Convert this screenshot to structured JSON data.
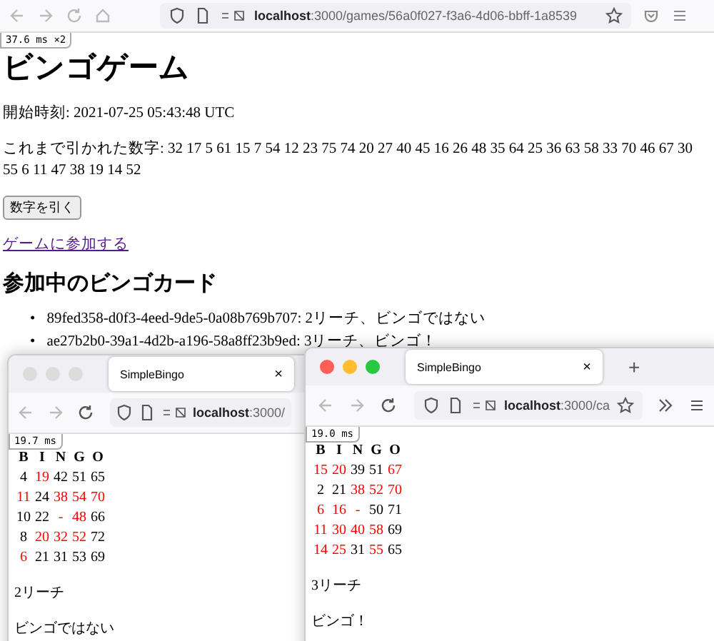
{
  "browser": {
    "url_host": "localhost",
    "url_path": ":3000/games/56a0f027-f3a6-4d06-bbff-1a8539",
    "perf_badge": "37.6 ms ×2"
  },
  "page": {
    "title": "ビンゴゲーム",
    "start_time": "開始時刻: 2021-07-25 05:43:48 UTC",
    "drawn_numbers": "これまで引かれた数字: 32 17 5 61 15 7 54 12 23 75 74 20 27 40 45 16 26 48 35 64 25 36 63 58 33 70 46 67 30 55 6 11 47 38 19 14 52",
    "draw_button": "数字を引く",
    "join_link": "ゲームに参加する",
    "cards_heading": "参加中のビンゴカード",
    "card_list": [
      {
        "marker": "•",
        "text": "89fed358-d0f3-4eed-9de5-0a08b769b707: 2リーチ、ビンゴではない"
      },
      {
        "marker": "•",
        "text": "ae27b2b0-39a1-4d2b-a196-58a8ff23b9ed: 3リーチ、ビンゴ！"
      }
    ]
  },
  "windows": [
    {
      "active": false,
      "tab_title": "SimpleBingo",
      "tab_close": "×",
      "url_host": "localhost",
      "url_path": ":3000/",
      "perf_badge": "19.7 ms",
      "header": [
        "B",
        "I",
        "N",
        "G",
        "O"
      ],
      "rows": [
        [
          {
            "n": "4",
            "marked": false
          },
          {
            "n": "19",
            "marked": true
          },
          {
            "n": "42",
            "marked": false
          },
          {
            "n": "51",
            "marked": false
          },
          {
            "n": "65",
            "marked": false
          }
        ],
        [
          {
            "n": "11",
            "marked": true
          },
          {
            "n": "24",
            "marked": false
          },
          {
            "n": "38",
            "marked": true
          },
          {
            "n": "54",
            "marked": true
          },
          {
            "n": "70",
            "marked": true
          }
        ],
        [
          {
            "n": "10",
            "marked": false
          },
          {
            "n": "22",
            "marked": false
          },
          {
            "n": "-",
            "marked": true
          },
          {
            "n": "48",
            "marked": true
          },
          {
            "n": "66",
            "marked": false
          }
        ],
        [
          {
            "n": "8",
            "marked": false
          },
          {
            "n": "20",
            "marked": true
          },
          {
            "n": "32",
            "marked": true
          },
          {
            "n": "52",
            "marked": true
          },
          {
            "n": "72",
            "marked": false
          }
        ],
        [
          {
            "n": "6",
            "marked": true
          },
          {
            "n": "21",
            "marked": false
          },
          {
            "n": "31",
            "marked": false
          },
          {
            "n": "53",
            "marked": false
          },
          {
            "n": "69",
            "marked": false
          }
        ]
      ],
      "reach": "2リーチ",
      "bingo": "ビンゴではない"
    },
    {
      "active": true,
      "tab_title": "SimpleBingo",
      "tab_close": "×",
      "new_tab": "+",
      "url_host": "localhost",
      "url_path": ":3000/ca",
      "perf_badge": "19.0 ms",
      "header": [
        "B",
        "I",
        "N",
        "G",
        "O"
      ],
      "rows": [
        [
          {
            "n": "15",
            "marked": true
          },
          {
            "n": "20",
            "marked": true
          },
          {
            "n": "39",
            "marked": false
          },
          {
            "n": "51",
            "marked": false
          },
          {
            "n": "67",
            "marked": true
          }
        ],
        [
          {
            "n": "2",
            "marked": false
          },
          {
            "n": "21",
            "marked": false
          },
          {
            "n": "38",
            "marked": true
          },
          {
            "n": "52",
            "marked": true
          },
          {
            "n": "70",
            "marked": true
          }
        ],
        [
          {
            "n": "6",
            "marked": true
          },
          {
            "n": "16",
            "marked": true
          },
          {
            "n": "-",
            "marked": true
          },
          {
            "n": "50",
            "marked": false
          },
          {
            "n": "71",
            "marked": false
          }
        ],
        [
          {
            "n": "11",
            "marked": true
          },
          {
            "n": "30",
            "marked": true
          },
          {
            "n": "40",
            "marked": true
          },
          {
            "n": "58",
            "marked": true
          },
          {
            "n": "69",
            "marked": false
          }
        ],
        [
          {
            "n": "14",
            "marked": true
          },
          {
            "n": "25",
            "marked": true
          },
          {
            "n": "31",
            "marked": false
          },
          {
            "n": "55",
            "marked": true
          },
          {
            "n": "65",
            "marked": false
          }
        ]
      ],
      "reach": "3リーチ",
      "bingo": "ビンゴ！"
    }
  ]
}
